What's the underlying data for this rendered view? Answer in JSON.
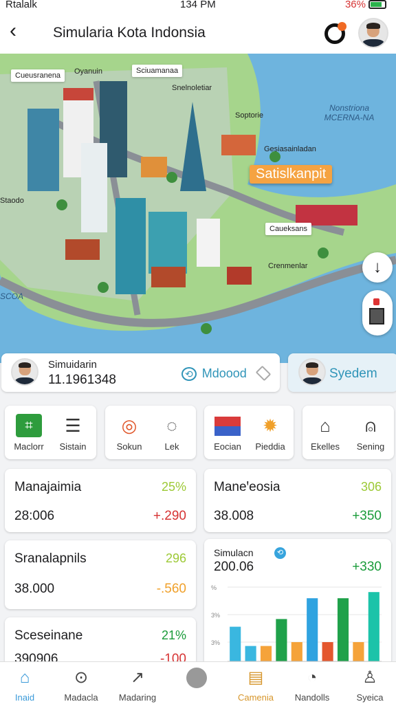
{
  "status_bar": {
    "carrier": "Rtalalk",
    "time": "134 PM",
    "battery": "36%"
  },
  "app_bar": {
    "title": "Simularia Kota Indonsia",
    "back_icon": "arrow-left-icon",
    "sync_icon": "sync-icon"
  },
  "map": {
    "labels": [
      "Cueusranena",
      "Oyanuin",
      "Sciuamanaa",
      "Snelnoletiar",
      "Soptorie",
      "Nonstriona MCERNA-NA",
      "Gesiasainladan",
      "Satislkanpit",
      "Staodo",
      "Caueksans",
      "Crenmenlar",
      "SCOA"
    ],
    "water_label_left": "SCOA",
    "compass_icon": "compass-arrow-icon",
    "zoom_icon": "zoom-control-icon"
  },
  "sim_card": {
    "label": "Simuidarin",
    "value": "11.1961348",
    "mode_label": "Mdoood",
    "mode_icon": "sync-icon"
  },
  "system_card": {
    "label": "Syedem"
  },
  "quick_actions": {
    "group1": [
      {
        "label": "Maclorr",
        "icon": "map-icon"
      },
      {
        "label": "Sistain",
        "icon": "list-icon"
      }
    ],
    "group2": [
      {
        "label": "Sokun",
        "icon": "target-icon"
      },
      {
        "label": "Lek",
        "icon": "chat-icon"
      }
    ],
    "group3": [
      {
        "label": "Eocian",
        "icon": "flag-icon"
      },
      {
        "label": "Pieddia",
        "icon": "sun-icon"
      }
    ],
    "group4": [
      {
        "label": "Ekelles",
        "icon": "government-icon"
      },
      {
        "label": "Sening",
        "icon": "user-icon"
      }
    ]
  },
  "stats": [
    {
      "title": "Manajaimia",
      "pct": "25%",
      "value": "28:006",
      "delta": "+.290"
    },
    {
      "title": "Maneꞌeosia",
      "pct": "306",
      "value": "38.008",
      "delta": "+350"
    },
    {
      "title": "Sranalapnils",
      "pct": "296",
      "value": "38.000",
      "delta": "-.560"
    },
    {
      "title": "Sceseinane",
      "pct": "21%",
      "value": "390906",
      "delta": "-100"
    }
  ],
  "chart_card": {
    "title": "Simulacn",
    "value": "200.06",
    "delta": "+330",
    "icon": "sync-icon"
  },
  "chart_data": {
    "type": "bar",
    "title": "",
    "yticks": [
      "%",
      "3%",
      "3%"
    ],
    "values": [
      45,
      20,
      20,
      55,
      25,
      82,
      25,
      82,
      25,
      90
    ],
    "colors": [
      "#3ab7e0",
      "#3ab7e0",
      "#f5a33a",
      "#1fa14a",
      "#f5a33a",
      "#2fa3e0",
      "#e4572e",
      "#1fa14a",
      "#f5a33a",
      "#1cc3a9"
    ],
    "ylim": [
      0,
      100
    ]
  },
  "tabs": [
    {
      "label": "Inaid",
      "icon": "home-icon",
      "state": "active"
    },
    {
      "label": "Madacla",
      "icon": "search-icon",
      "state": ""
    },
    {
      "label": "Madaring",
      "icon": "trend-icon",
      "state": ""
    },
    {
      "label": "",
      "icon": "avatar-icon",
      "state": ""
    },
    {
      "label": "Camenia",
      "icon": "calendar-icon",
      "state": "warm"
    },
    {
      "label": "Nandolls",
      "icon": "gauge-icon",
      "state": ""
    },
    {
      "label": "Syeica",
      "icon": "profile-icon",
      "state": ""
    }
  ],
  "colors": {
    "accent": "#3a9ad9",
    "water": "#6eb4de",
    "land": "#a6d58c",
    "positive": "#199b39",
    "negative": "#d63333",
    "warning": "#f0a02a"
  }
}
